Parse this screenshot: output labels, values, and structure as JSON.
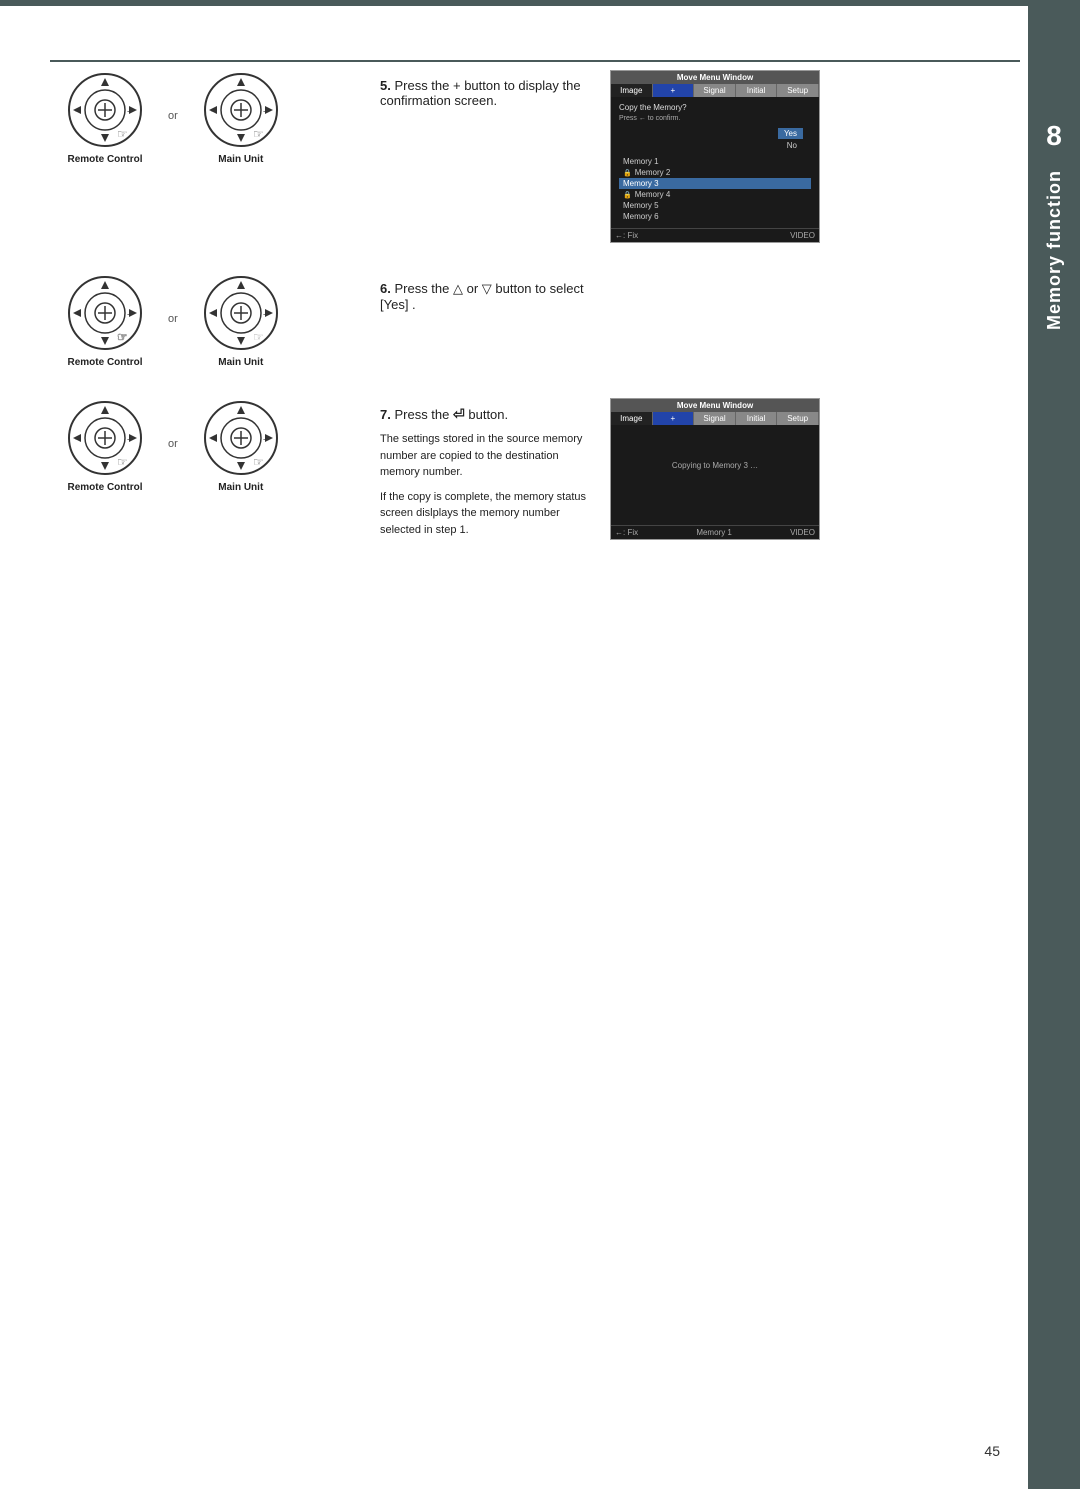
{
  "page": {
    "number": "45",
    "chapter_number": "8",
    "chapter_title": "Memory function"
  },
  "steps": {
    "step5": {
      "number": "5.",
      "text": "Press the + button to display the confirmation screen."
    },
    "step6": {
      "number": "6.",
      "text": "Press the △ or ▽ button to select [Yes] ."
    },
    "step7": {
      "number": "7.",
      "label": "Press the",
      "button_symbol": "⏎",
      "after": "button.",
      "body1": "The settings stored in the source memory number are copied to the destination memory number.",
      "body2": "If the copy is complete, the memory status screen dislplays the memory number selected in step 1."
    }
  },
  "labels": {
    "remote_control": "Remote Control",
    "main_unit": "Main Unit",
    "or": "or"
  },
  "screens": {
    "screen1": {
      "title": "Move Menu Window",
      "tabs": [
        "Image",
        "+",
        "Signal",
        "Initial",
        "Setup"
      ],
      "copy_prompt": "Copy the Memory?",
      "press_prompt": "Press ← to confirm.",
      "yes": "Yes",
      "no": "No",
      "memories": [
        "Memory 1",
        "Memory 2",
        "Memory 3",
        "Memory 4",
        "Memory 5",
        "Memory 6"
      ],
      "locked": [
        "Memory 2",
        "Memory 4"
      ],
      "selected": "Memory 3",
      "footer_left": "←: Fix",
      "footer_right": "VIDEO"
    },
    "screen2": {
      "title": "Move Menu Window",
      "tabs": [
        "Image",
        "+",
        "Signal",
        "Initial",
        "Setup"
      ],
      "copy_msg": "Copying to Memory 3 …",
      "footer_left": "←: Fix",
      "footer_memory": "Memory 1",
      "footer_right": "VIDEO"
    }
  }
}
